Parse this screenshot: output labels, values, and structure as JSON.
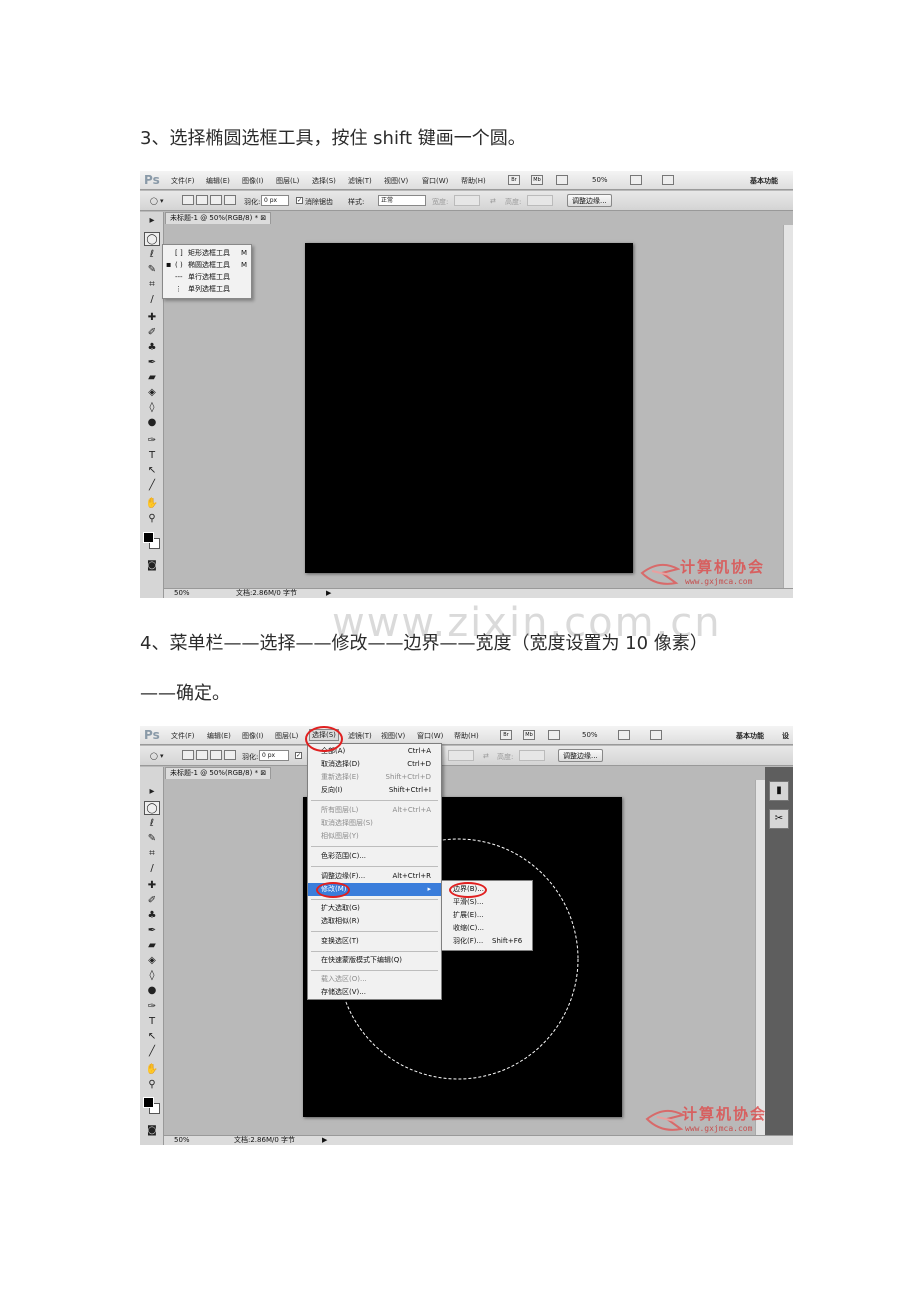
{
  "step3_text": "3、选择椭圆选框工具，按住 shift 键画一个圆。",
  "step4_line1": "4、菜单栏——选择——修改——边界——宽度（宽度设置为 10 像素）",
  "step4_line2": "——确定。",
  "page_watermark": "www.zixin.com.cn",
  "ps": {
    "logo": "Ps",
    "menus": [
      "文件(F)",
      "编辑(E)",
      "图像(I)",
      "图层(L)",
      "选择(S)",
      "滤镜(T)",
      "视图(V)",
      "窗口(W)",
      "帮助(H)"
    ],
    "bridge": "Br",
    "minibridge": "Mb",
    "zoom": "50%",
    "workspace": "基本功能",
    "workspace_more": "设",
    "feather_label": "羽化:",
    "feather_value": "0 px",
    "antialias_label": "消除锯齿",
    "style_label": "样式:",
    "style_value": "正常",
    "width_label": "宽度:",
    "height_label": "高度:",
    "refine_button": "调整边缘...",
    "doc_tab": "未标题-1 @ 50%(RGB/8) *",
    "status_zoom": "50%",
    "status_doc": "文档:2.86M/0 字节"
  },
  "flyout": {
    "items": [
      {
        "label": "矩形选框工具",
        "key": "M",
        "icon": "[ ]",
        "selected": false
      },
      {
        "label": "椭圆选框工具",
        "key": "M",
        "icon": "( )",
        "selected": true
      },
      {
        "label": "单行选框工具",
        "key": "",
        "icon": "===",
        "selected": false
      },
      {
        "label": "单列选框工具",
        "key": "",
        "icon": "⋮",
        "selected": false
      }
    ]
  },
  "select_menu": {
    "items": [
      {
        "label": "全部(A)",
        "key": "Ctrl+A",
        "state": "normal"
      },
      {
        "label": "取消选择(D)",
        "key": "Ctrl+D",
        "state": "normal"
      },
      {
        "label": "重新选择(E)",
        "key": "Shift+Ctrl+D",
        "state": "disabled"
      },
      {
        "label": "反向(I)",
        "key": "Shift+Ctrl+I",
        "state": "normal"
      },
      {
        "label": "所有图层(L)",
        "key": "Alt+Ctrl+A",
        "state": "disabled"
      },
      {
        "label": "取消选择图层(S)",
        "key": "",
        "state": "disabled"
      },
      {
        "label": "相似图层(Y)",
        "key": "",
        "state": "disabled"
      },
      {
        "label": "色彩范围(C)...",
        "key": "",
        "state": "normal"
      },
      {
        "label": "调整边缘(F)...",
        "key": "Alt+Ctrl+R",
        "state": "normal"
      },
      {
        "label": "修改(M)",
        "key": "",
        "state": "highlight"
      },
      {
        "label": "扩大选取(G)",
        "key": "",
        "state": "normal"
      },
      {
        "label": "选取相似(R)",
        "key": "",
        "state": "normal"
      },
      {
        "label": "变换选区(T)",
        "key": "",
        "state": "normal"
      },
      {
        "label": "在快速蒙版模式下编辑(Q)",
        "key": "",
        "state": "normal"
      },
      {
        "label": "载入选区(O)...",
        "key": "",
        "state": "disabled"
      },
      {
        "label": "存储选区(V)...",
        "key": "",
        "state": "normal"
      }
    ]
  },
  "modify_submenu": {
    "items": [
      {
        "label": "边界(B)...",
        "key": ""
      },
      {
        "label": "平滑(S)...",
        "key": ""
      },
      {
        "label": "扩展(E)...",
        "key": ""
      },
      {
        "label": "收缩(C)...",
        "key": ""
      },
      {
        "label": "羽化(F)...",
        "key": "Shift+F6"
      }
    ]
  },
  "logo_watermark": {
    "text": "计算机协会",
    "url": "www.gxjmca.com"
  },
  "colors": {
    "highlight": "#3a7ddb",
    "annotation": "#e02020",
    "canvas": "#000000"
  }
}
